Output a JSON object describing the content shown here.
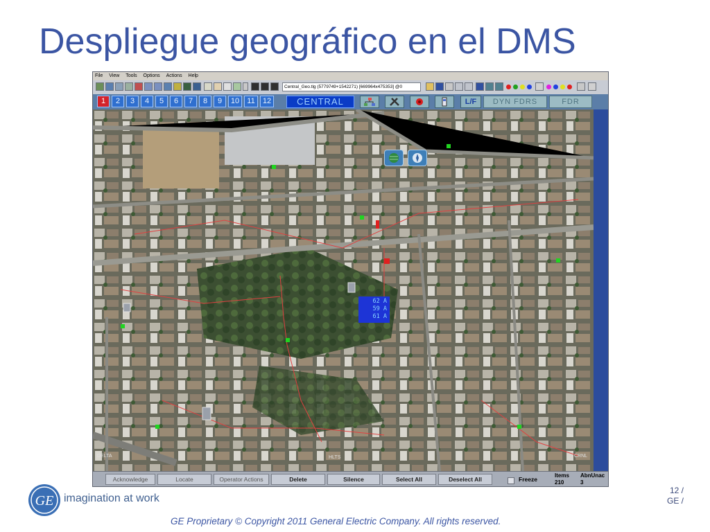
{
  "slide": {
    "title": "Despliegue geográfico en el DMS",
    "tagline": "imagination at work",
    "page_number": "12 /",
    "page_company": "GE /",
    "copyright": "GE Proprietary © Copyright 2011 General Electric Company. All rights reserved.",
    "logo_text": "GE"
  },
  "app": {
    "menu": [
      "File",
      "View",
      "Tools",
      "Options",
      "Actions",
      "Help"
    ],
    "file_field": "Central_Geo.tlg (5779749+1542271) [669964x475353] @0",
    "number_tabs": [
      "1",
      "2",
      "3",
      "4",
      "5",
      "6",
      "7",
      "8",
      "9",
      "10",
      "11",
      "12"
    ],
    "active_tab": "1",
    "central_tab": "CENTRAL",
    "lf_tab": "L/F",
    "dyn_tab": "DYN FDRS",
    "fdr_tab": "FDR",
    "map_label_left": "DELTA",
    "map_label_mid": "HLTS",
    "map_label_right": "CRNL",
    "amp_readings": [
      "62 A",
      "59 A",
      "61 A"
    ],
    "bottom_buttons": {
      "acknowledge": "Acknowledge",
      "locate": "Locate",
      "operator_actions": "Operator Actions",
      "delete": "Delete",
      "silence": "Silence",
      "select_all": "Select All",
      "deselect_all": "Deselect All",
      "freeze": "Freeze"
    },
    "stats": {
      "items_label": "Items",
      "items_value": "210",
      "abn_label": "AbnUnac",
      "abn_value": "3"
    }
  },
  "colors": {
    "title": "#3b55a3",
    "active_tab": "#d4232b",
    "tab": "#2f6fcf",
    "central_tab": "#0a3cc6",
    "amp_box": "#1d34d6"
  },
  "icons": [
    "toolbar-icons",
    "network-tree-icon",
    "tools-icon",
    "alarm-icon",
    "device-icon",
    "globe-icon",
    "compass-icon"
  ]
}
